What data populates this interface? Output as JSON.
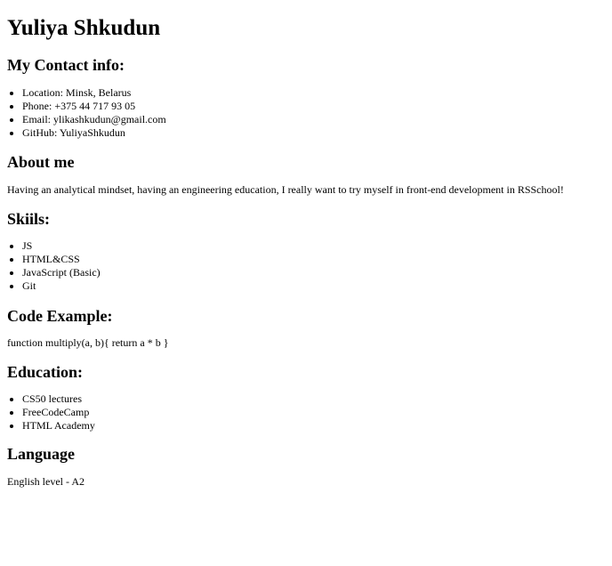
{
  "name": "Yuliya Shkudun",
  "contact": {
    "heading": "My Contact info:",
    "items": [
      "Location: Minsk, Belarus",
      "Phone: +375 44 717 93 05",
      "Email: ylikashkudun@gmail.com",
      "GitHub: YuliyaShkudun"
    ]
  },
  "about": {
    "heading": "About me",
    "text": "Having an analytical mindset, having an engineering education, I really want to try myself in front-end development in RSSchool!"
  },
  "skills": {
    "heading": "Skiils:",
    "items": [
      "JS",
      "HTML&CSS",
      "JavaScript (Basic)",
      "Git"
    ]
  },
  "code": {
    "heading": "Code Example:",
    "text": "function multiply(a, b){ return a * b }"
  },
  "education": {
    "heading": "Education:",
    "items": [
      "CS50 lectures",
      "FreeCodeCamp",
      "HTML Academy"
    ]
  },
  "language": {
    "heading": "Language",
    "text": "English level - A2"
  }
}
